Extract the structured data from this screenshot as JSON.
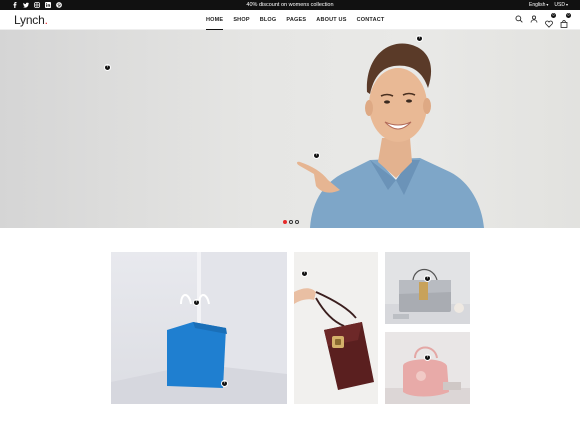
{
  "topbar": {
    "socials": [
      "facebook-icon",
      "twitter-icon",
      "instagram-icon",
      "linkedin-icon",
      "pinterest-icon"
    ],
    "promo": "40% discount on womens collection",
    "language": "English",
    "currency": "USD"
  },
  "header": {
    "logo_text": "Lynch",
    "logo_dot": ".",
    "nav": [
      {
        "label": "HOME",
        "active": true
      },
      {
        "label": "SHOP",
        "active": false
      },
      {
        "label": "BLOG",
        "active": false
      },
      {
        "label": "PAGES",
        "active": false
      },
      {
        "label": "ABOUT US",
        "active": false
      },
      {
        "label": "CONTACT",
        "active": false
      }
    ],
    "wishlist_count": "0",
    "cart_count": "0"
  },
  "hero": {
    "slides": 3,
    "active_slide": 0
  },
  "hotspot_symbol": "+",
  "colors": {
    "accent": "#e52a2a",
    "topbar_bg": "#111111",
    "bag_blue": "#1f7fd0",
    "shirt": "#7ea6c8"
  }
}
